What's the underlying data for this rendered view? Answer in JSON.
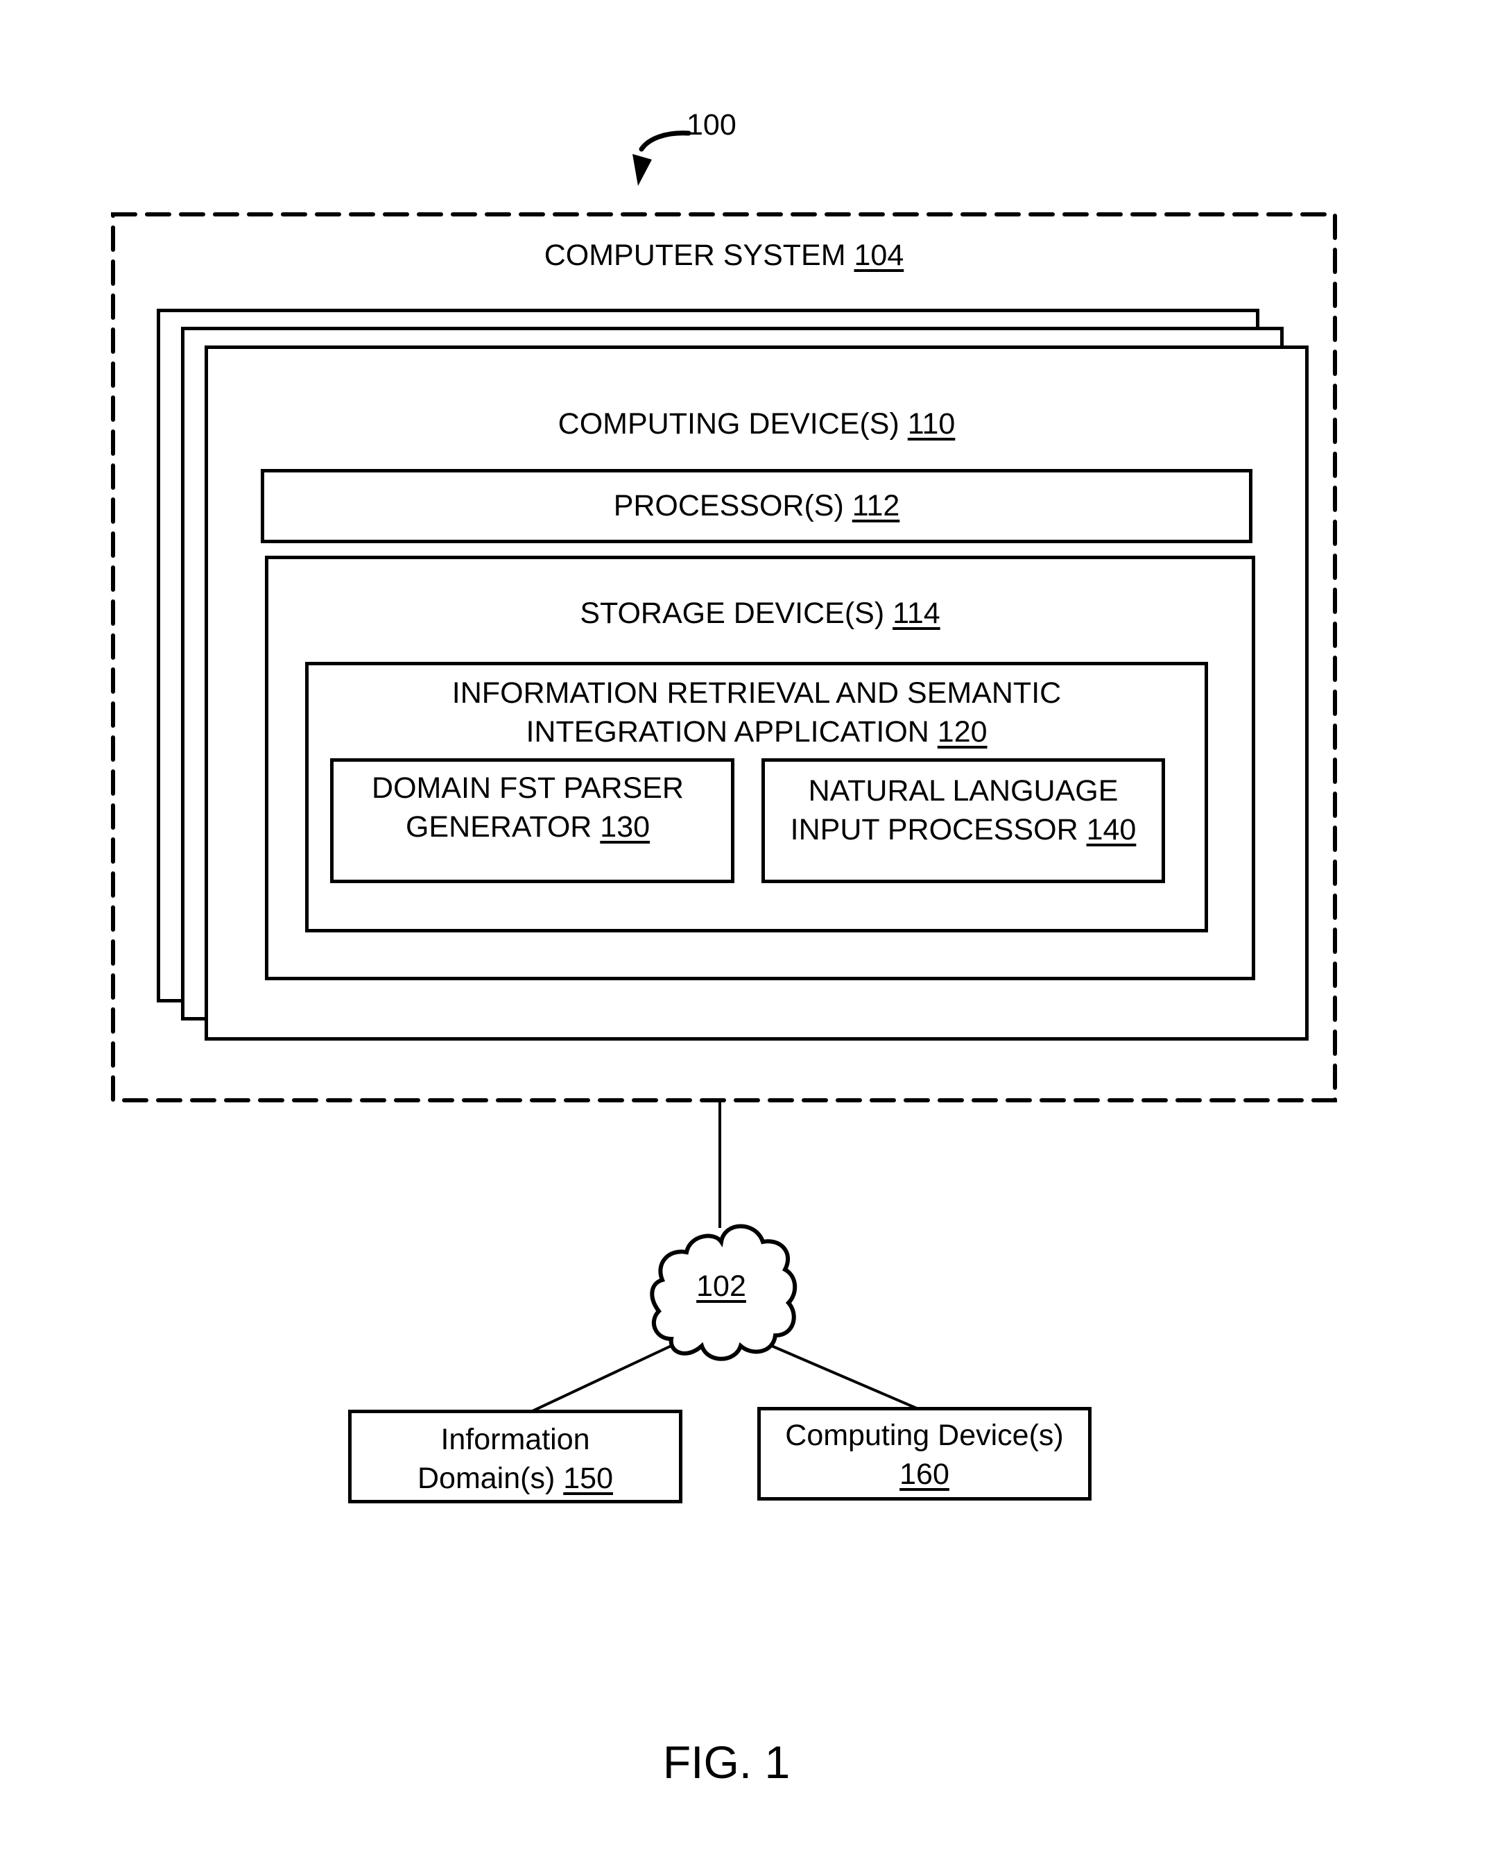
{
  "figure": {
    "ref_number": "100",
    "caption": "FIG. 1"
  },
  "computer_system": {
    "label": "COMPUTER SYSTEM",
    "ref": "104"
  },
  "computing_devices": {
    "label": "COMPUTING DEVICE(S)",
    "ref": "110"
  },
  "processors": {
    "label": "PROCESSOR(S)",
    "ref": "112"
  },
  "storage": {
    "label": "STORAGE DEVICE(S)",
    "ref": "114"
  },
  "application": {
    "line1": "INFORMATION RETRIEVAL AND SEMANTIC",
    "line2": "INTEGRATION APPLICATION",
    "ref": "120"
  },
  "fst_parser": {
    "line1": "DOMAIN FST PARSER",
    "line2": "GENERATOR",
    "ref": "130"
  },
  "nl_processor": {
    "line1": "NATURAL LANGUAGE",
    "line2": "INPUT PROCESSOR",
    "ref": "140"
  },
  "network": {
    "ref": "102"
  },
  "info_domains": {
    "line1": "Information",
    "line2": "Domain(s)",
    "ref": "150"
  },
  "remote_devices": {
    "line1": "Computing Device(s)",
    "ref": "160"
  }
}
